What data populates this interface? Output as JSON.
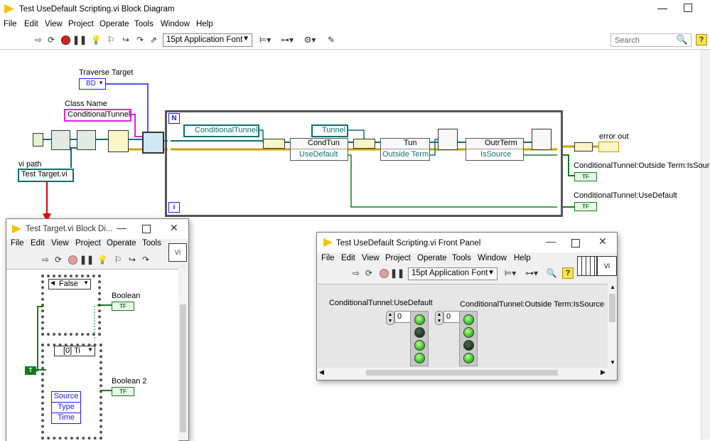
{
  "main_window": {
    "title": "Test UseDefault Scripting.vi Block Diagram",
    "menu": [
      "File",
      "Edit",
      "View",
      "Project",
      "Operate",
      "Tools",
      "Window",
      "Help"
    ],
    "font_select": "15pt Application Font",
    "search_placeholder": "Search"
  },
  "diagram": {
    "traverse_target_label": "Traverse Target",
    "traverse_target_value": "BD",
    "class_name_label": "Class Name",
    "class_name_value": "ConditionalTunnel",
    "vi_path_label": "vi path",
    "vi_path_value": "Test Target.vi",
    "loop_n": "N",
    "loop_i": "i",
    "class_conditional_tunnel": "ConditionalTunnel",
    "class_tunnel": "Tunnel",
    "prop_node1_class": "CondTun",
    "prop_node1_prop": "UseDefault",
    "prop_node2_class": "Tun",
    "prop_node2_prop": "Outside Term",
    "prop_node3_class": "OutrTerm",
    "prop_node3_prop": "IsSource",
    "error_out": "error out",
    "ind1_label": "ConditionalTunnel:Outside Term:IsSource",
    "ind2_label": "ConditionalTunnel:UseDefault",
    "tf": "TF"
  },
  "target_window": {
    "title": "Test Target.vi Block Di...",
    "menu": [
      "File",
      "Edit",
      "View",
      "Project",
      "Operate",
      "Tools"
    ],
    "case_value": "False",
    "boolean_label": "Boolean",
    "boolean2_label": "Boolean 2",
    "event_value": "[0] Ti",
    "event_items": [
      "Source",
      "Type",
      "Time"
    ],
    "true_const": "T"
  },
  "front_panel": {
    "title": "Test UseDefault Scripting.vi Front Panel",
    "menu": [
      "File",
      "Edit",
      "View",
      "Project",
      "Operate",
      "Tools",
      "Window",
      "Help"
    ],
    "font_select": "15pt Application Font",
    "array1_label": "ConditionalTunnel:UseDefault",
    "array2_label": "ConditionalTunnel:Outside Term:IsSource",
    "index1": "0",
    "index2": "0",
    "array1_leds": [
      true,
      false,
      true,
      true
    ],
    "array2_leds": [
      true,
      true,
      false,
      true
    ]
  },
  "colors": {
    "boolean_wire": "#137b1e",
    "refnum_wire": "#0f6e6e",
    "class_name_border": "#e020e0",
    "error_wire": "#c8a000",
    "arrow": "#e00000"
  }
}
